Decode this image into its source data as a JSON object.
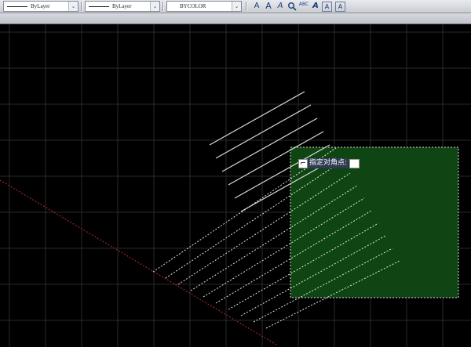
{
  "toolbar": {
    "linetype_value": "ByLayer",
    "lineweight_value": "ByLayer",
    "color_value": "BYCOLOR",
    "dropdown_arrow": "⌄"
  },
  "text_tools": {
    "multiline_text_glyph": "A",
    "single_line_text_glyph": "A",
    "edit_text_glyph": "A",
    "find_replace_icon": "search-icon",
    "spell_check_glyph": "ABC",
    "text_style_glyph": "A",
    "scale_text_glyph": "A",
    "justify_text_glyph": "A"
  },
  "command_prompt": {
    "icon_glyph": "⌐",
    "text": "指定对角点:",
    "input_value": ""
  },
  "colors": {
    "background": "#000000",
    "grid": "#2a2a2a",
    "selection_fill": "#0f4512",
    "selection_border": "#d8d8d8",
    "solid_lines": "#d9d9d9",
    "dashed_lines": "#e6e6e6",
    "axis_line": "#b03030"
  }
}
